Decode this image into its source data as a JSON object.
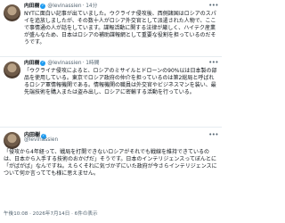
{
  "tweets": [
    {
      "name": "内田樹",
      "handle": "@levinassien",
      "time": "· 14分",
      "text": "NYTに面白い記事が出ていました。ウクライナ侵攻後、西側諸国はロシアのスパイを追放しましたが、その数十人がロシア外交官として派遣された人物で、ここで事情通の人が話をしています。諜報活動に関する法律が厳しく、ハイテク産業が盛んなため、日本はロシアの補助諜報網として重要な役割を担っているのだそうです。"
    },
    {
      "name": "内田樹",
      "handle": "@levinassien",
      "time": "· 1時間",
      "text": "「ウクライナ侵攻によると、ロシアのミサイルとドローンの90%以は日本製の部品を使用している。東京でロシア政府の仲介を担っているのは第2総局と呼ばれるロシア軍情報機関である。情報機関の職員は外交官やビジネスマンを装い、最先端技術を購入または盗み出し、ロシアに密輸する活動を行っている。"
    },
    {
      "name": "内田樹",
      "handle": "@levinassien",
      "text": "「侵攻から4年経って、戦局を打開できないロシアがそれでも戦線を維持できているのは、日本から入手する技術のおかげだ」そうです。日本のインテリジェンスってぼんとに「がばがば」なんですね。えらくそれに気づかずにいた政府が今さらインテリジェンスについて何か言ってても様に思えません。",
      "stamp": "午後10:08 · 2026年7月14日 · 6件の表示"
    }
  ],
  "icons": {
    "verified": "verified-badge-icon",
    "more": "more-options-icon"
  },
  "colors": {
    "accent": "#1d9bf0",
    "secondary_text": "#536471",
    "divider": "#e6ecf0"
  }
}
